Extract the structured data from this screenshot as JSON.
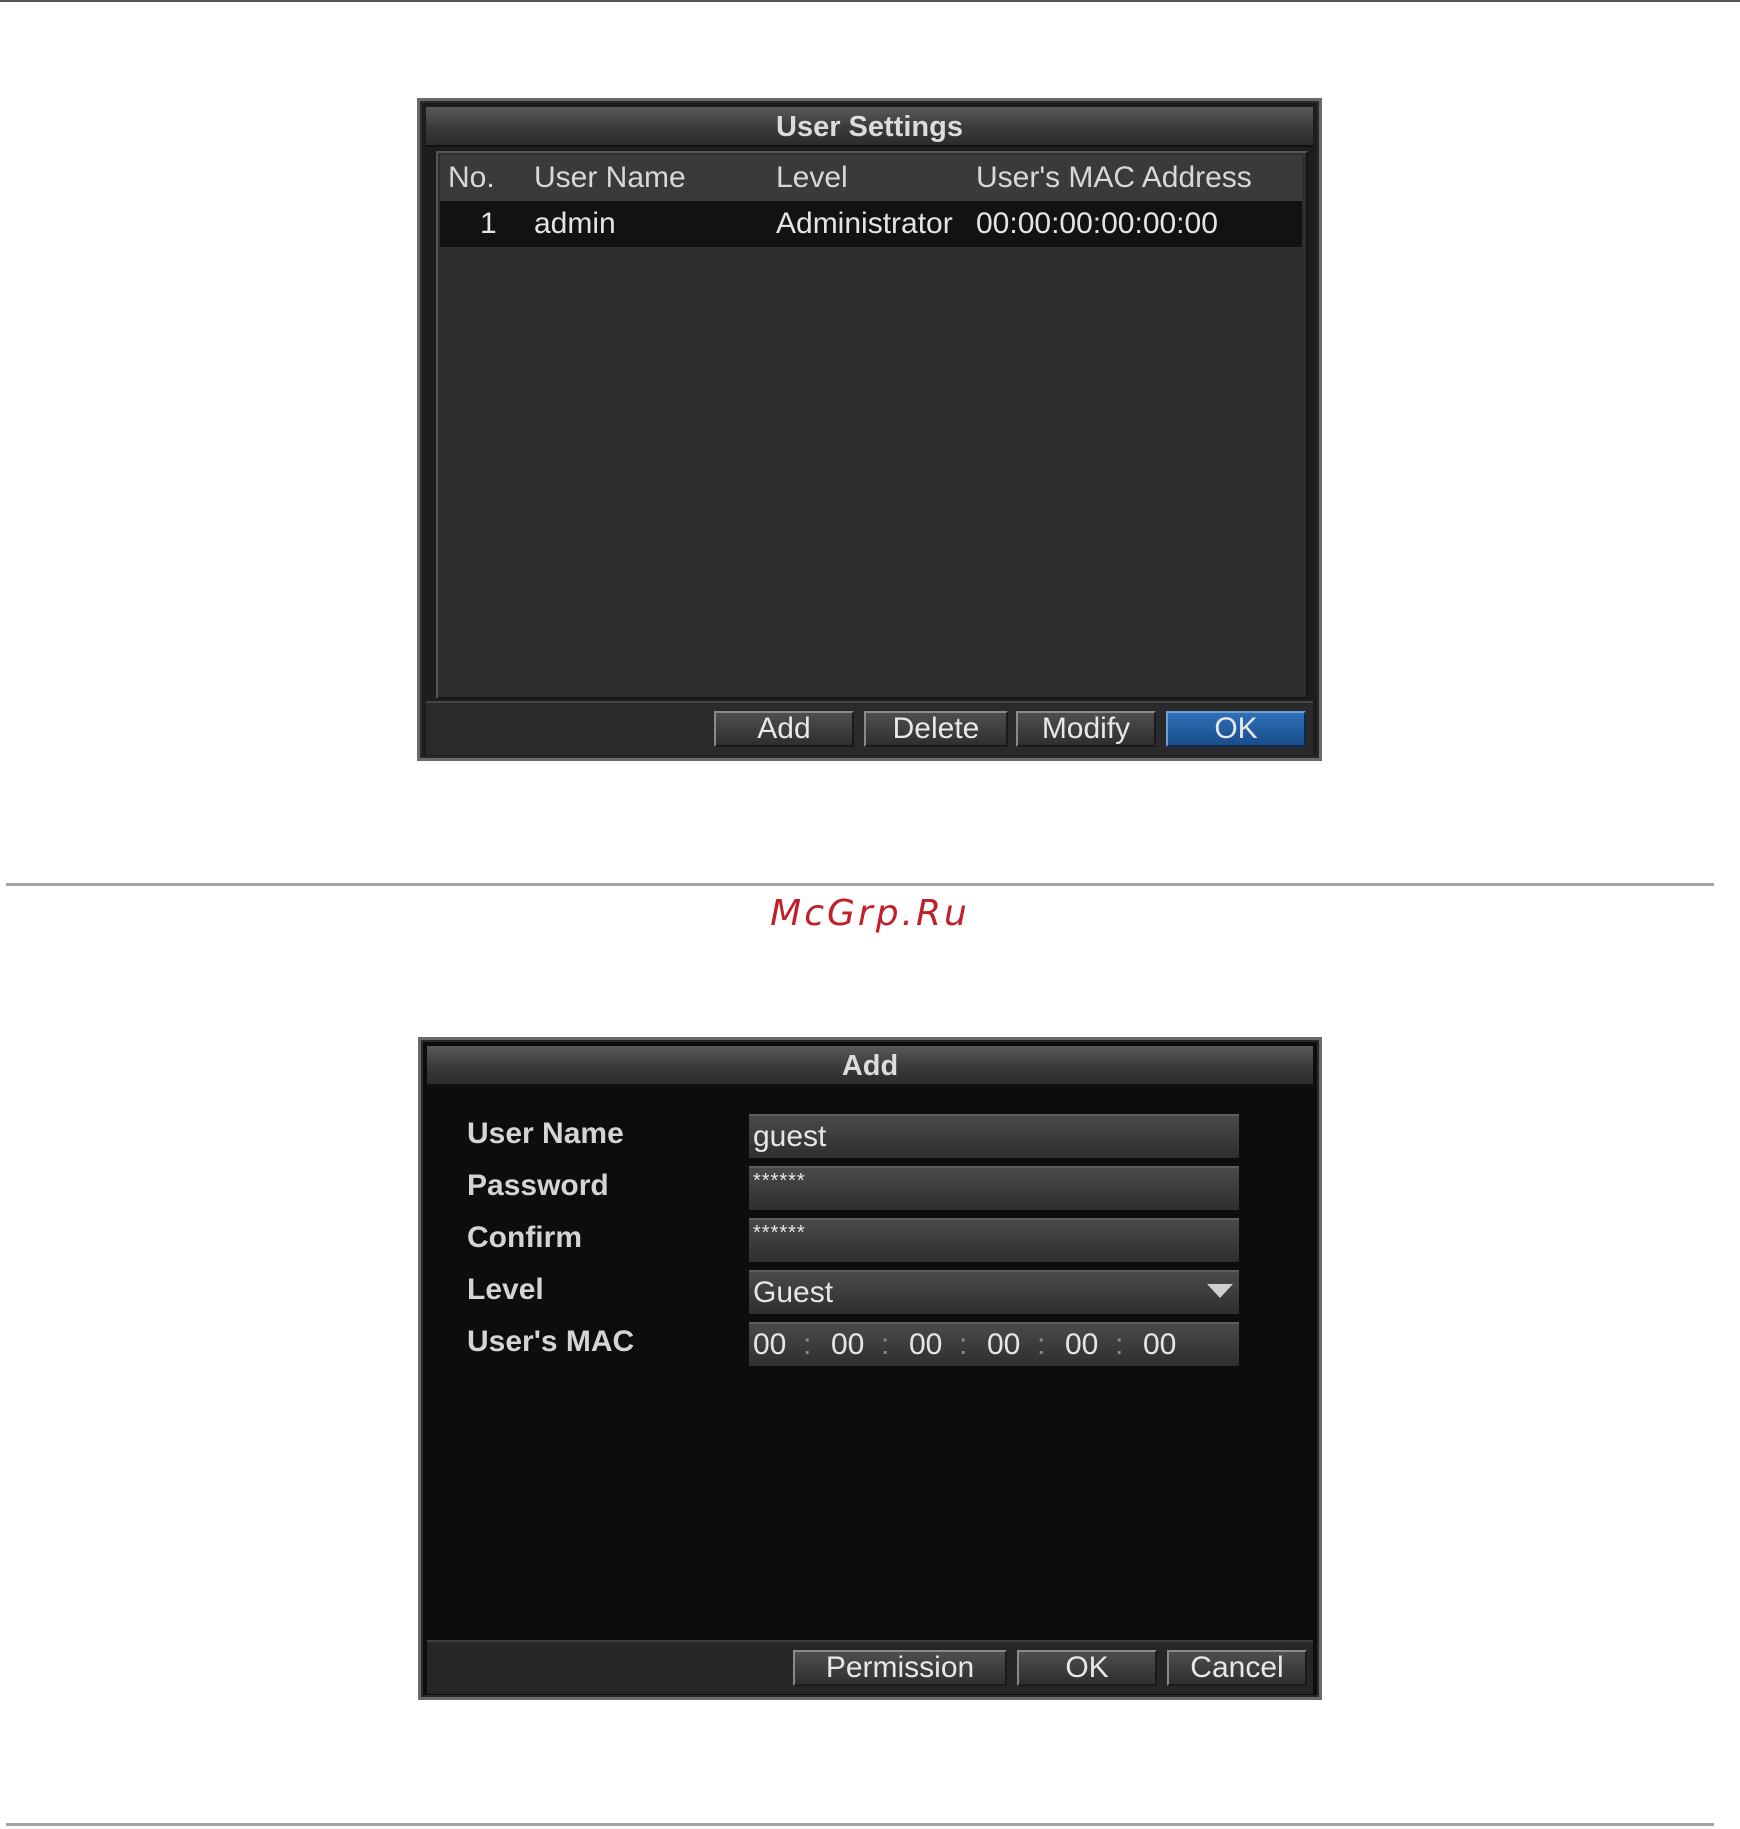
{
  "user_settings": {
    "title": "User Settings",
    "columns": [
      "No.",
      "User Name",
      "Level",
      "User's MAC Address"
    ],
    "rows": [
      {
        "no": "1",
        "user_name": "admin",
        "level": "Administrator",
        "mac": "00:00:00:00:00:00"
      }
    ],
    "buttons": {
      "add": "Add",
      "delete": "Delete",
      "modify": "Modify",
      "ok": "OK"
    }
  },
  "watermark": "McGrp.Ru",
  "add_dialog": {
    "title": "Add",
    "labels": {
      "user_name": "User Name",
      "password": "Password",
      "confirm": "Confirm",
      "level": "Level",
      "mac": "User's MAC"
    },
    "values": {
      "user_name": "guest",
      "password": "******",
      "confirm": "******",
      "level": "Guest",
      "mac": [
        "00",
        "00",
        "00",
        "00",
        "00",
        "00"
      ]
    },
    "buttons": {
      "permission": "Permission",
      "ok": "OK",
      "cancel": "Cancel"
    }
  },
  "colors": {
    "primary_button": "#1a4d8a",
    "watermark": "#c0202a"
  }
}
